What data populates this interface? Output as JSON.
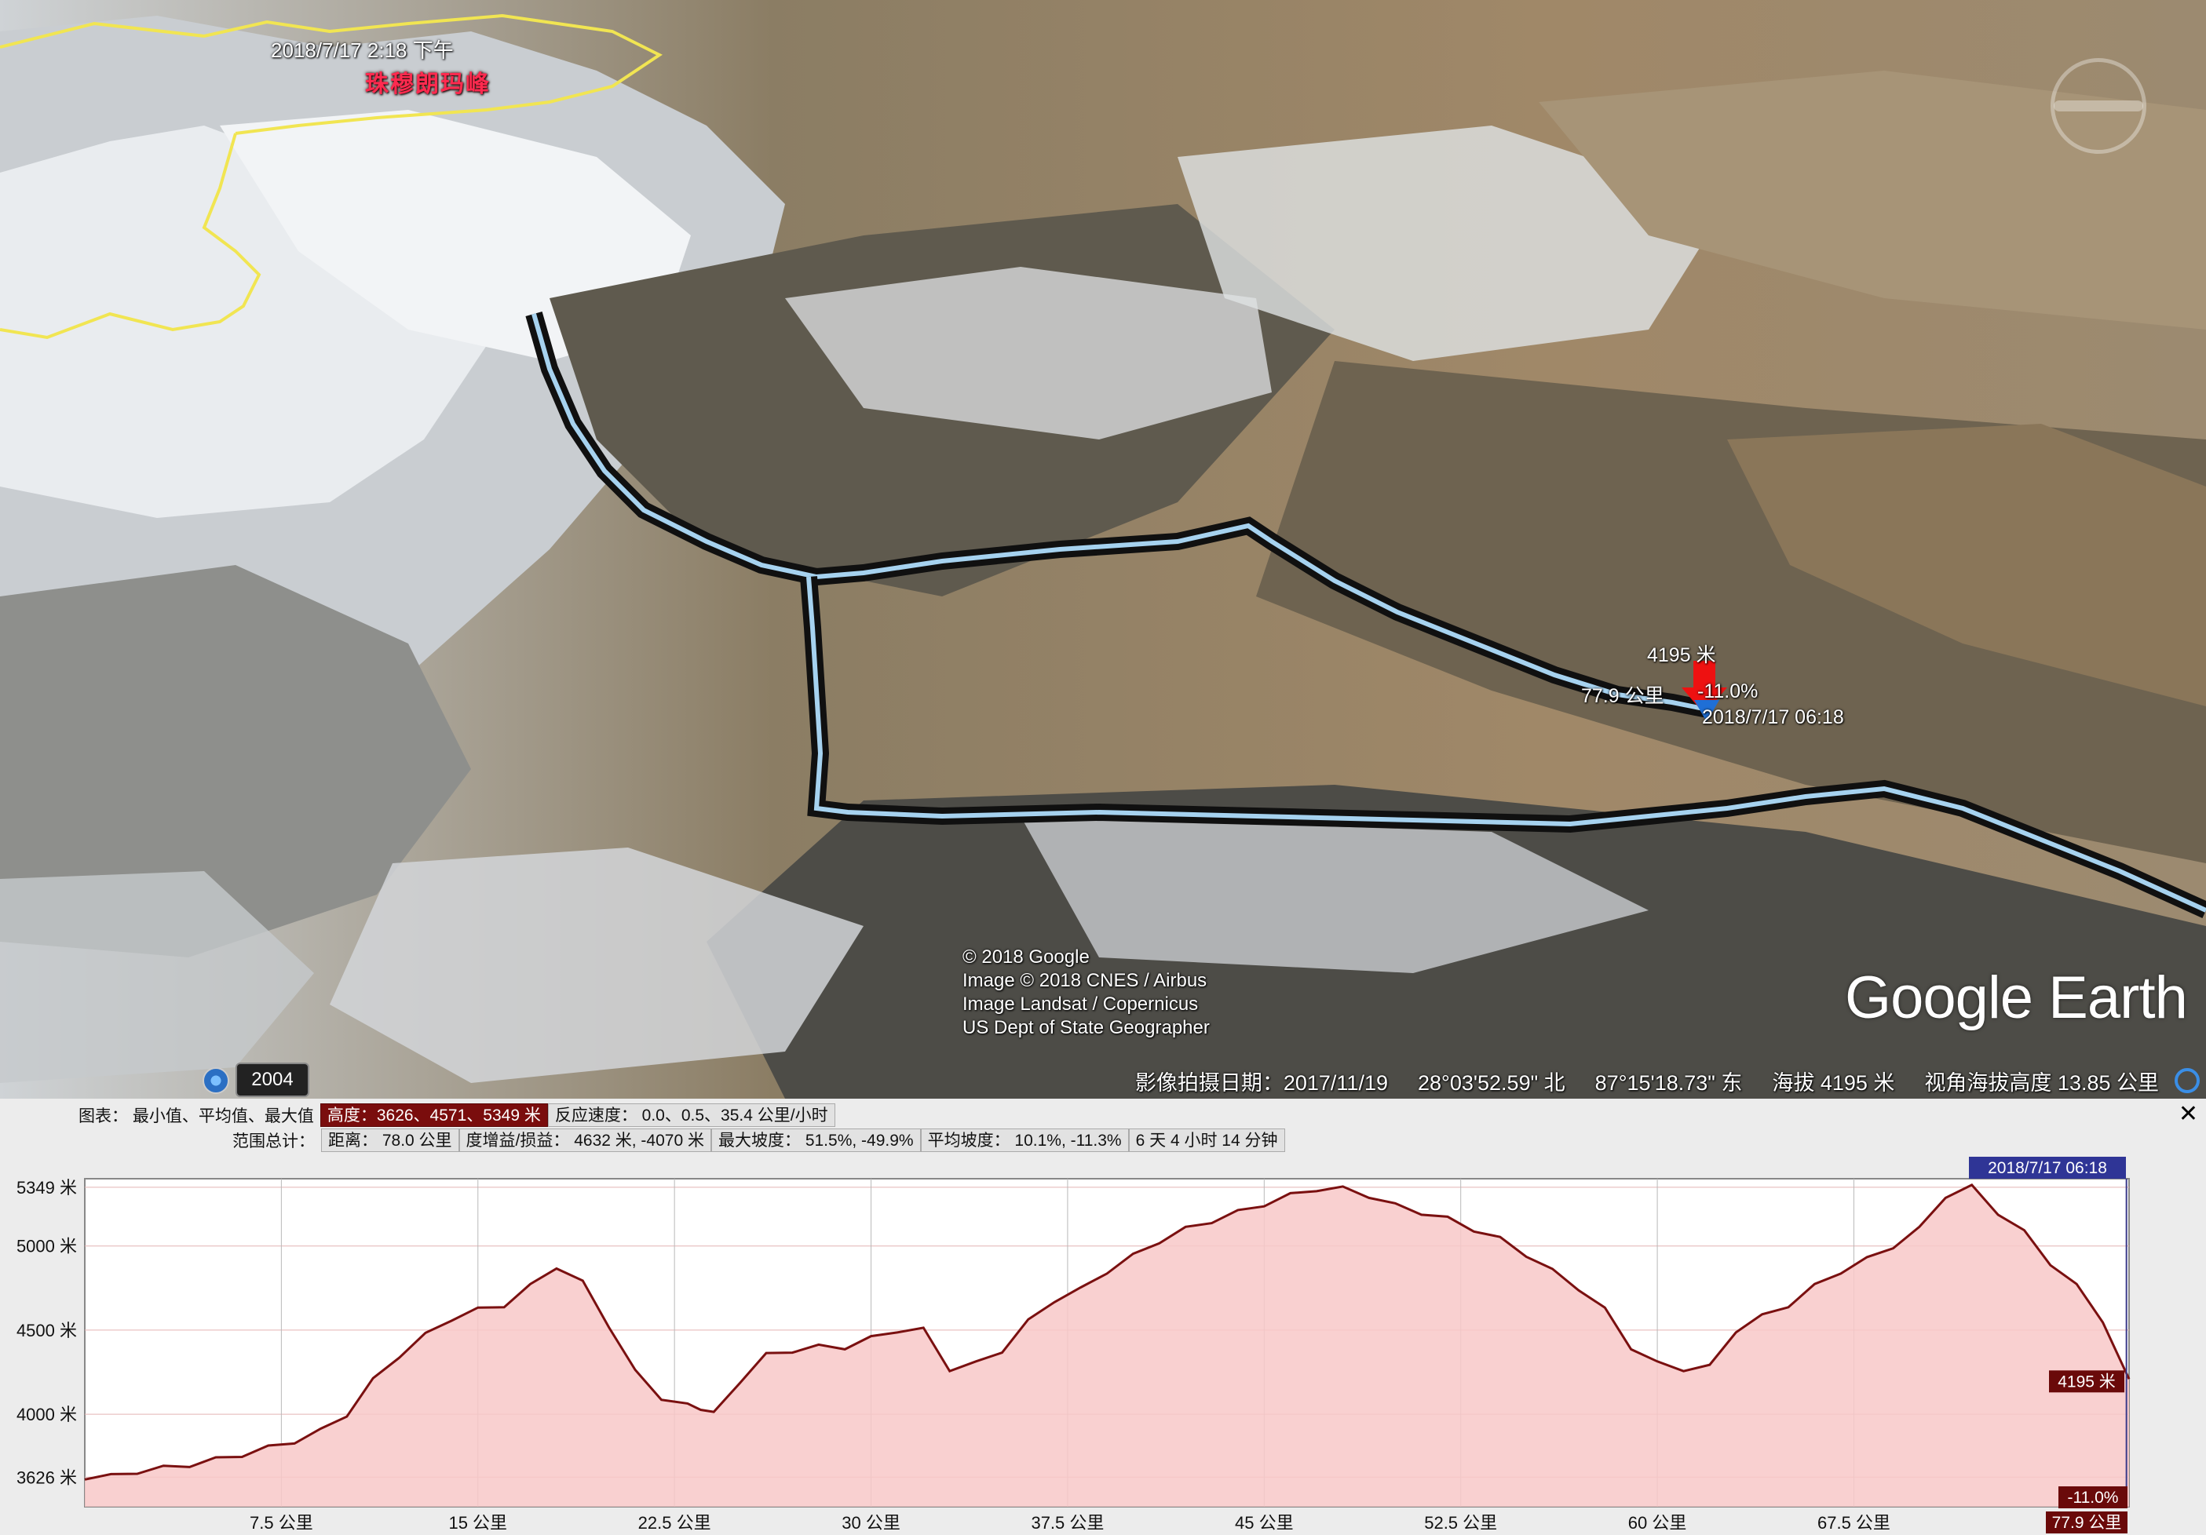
{
  "map": {
    "placemark_date": "2018/7/17  2:18 下午",
    "peak_label": "珠穆朗玛峰",
    "cursor": {
      "elevation": "4195 米",
      "distance": "77.9 公里",
      "grade": "-11.0%",
      "time": "2018/7/17 06:18"
    },
    "copyright": [
      "© 2018 Google",
      "Image © 2018 CNES / Airbus",
      "Image Landsat / Copernicus",
      "US Dept of State Geographer"
    ],
    "logo": "Google Earth",
    "time_slider_year": "2004"
  },
  "status_bar": {
    "imagery_date": "影像拍摄日期：2017/11/19",
    "latitude": "28°03'52.59\" 北",
    "longitude": "87°15'18.73\" 东",
    "elevation": "海拔  4195 米",
    "eye_altitude": "视角海拔高度  13.85 公里"
  },
  "profile": {
    "chart_row_label": "图表：  最小值、平均值、最大值",
    "chart_cells": [
      "高度：3626、4571、5349 米",
      "反应速度：  0.0、0.5、35.4 公里/小时"
    ],
    "range_row_label": "范围总计：",
    "range_cells": [
      "距离：  78.0 公里",
      "度增益/损益：  4632 米, -4070 米",
      "最大坡度：  51.5%, -49.9%",
      "平均坡度：  10.1%, -11.3%",
      "6 天 4 小时 14 分钟"
    ],
    "cursor_time": "2018/7/17 06:18",
    "cursor_elevation": "4195 米",
    "cursor_grade": "-11.0%",
    "cursor_distance": "77.9 公里"
  },
  "chart_data": {
    "type": "area",
    "xlabel": "",
    "ylabel": "",
    "x_unit": "公里",
    "y_unit": "米",
    "xlim": [
      0,
      78.0
    ],
    "ylim": [
      3450,
      5400
    ],
    "y_ticks": [
      3626,
      4000,
      4500,
      5000,
      5349
    ],
    "y_tick_labels": [
      "3626 米",
      "4000 米",
      "4500 米",
      "5000 米",
      "5349 米"
    ],
    "x_ticks": [
      7.5,
      15,
      22.5,
      30,
      37.5,
      45,
      52.5,
      60,
      67.5
    ],
    "x_tick_labels": [
      "7.5 公里",
      "15 公里",
      "22.5 公里",
      "30 公里",
      "37.5 公里",
      "45 公里",
      "52.5 公里",
      "60 公里",
      "67.5 公里"
    ],
    "cursor_x": 77.9,
    "series": [
      {
        "x": [
          0,
          1,
          2,
          3,
          4,
          5,
          6,
          7,
          8,
          9,
          10,
          11,
          12,
          13,
          14,
          15,
          16,
          17,
          18,
          19,
          20,
          21,
          22,
          23,
          23.5,
          24,
          25,
          26,
          27,
          28,
          29,
          30,
          31,
          32,
          33,
          34,
          35,
          36,
          37,
          38,
          39,
          40,
          41,
          42,
          43,
          44,
          45,
          46,
          47,
          48,
          49,
          50,
          51,
          52,
          53,
          54,
          55,
          56,
          57,
          58,
          59,
          60,
          61,
          62,
          63,
          64,
          65,
          66,
          67,
          68,
          69,
          70,
          71,
          72,
          73,
          74,
          75,
          76,
          77,
          78
        ],
        "y": [
          3626,
          3630,
          3660,
          3680,
          3700,
          3730,
          3760,
          3800,
          3840,
          3900,
          4000,
          4200,
          4350,
          4470,
          4570,
          4620,
          4650,
          4760,
          4880,
          4780,
          4530,
          4250,
          4100,
          4050,
          4040,
          4000,
          4200,
          4350,
          4380,
          4400,
          4400,
          4450,
          4500,
          4500,
          4270,
          4300,
          4380,
          4550,
          4680,
          4740,
          4850,
          4940,
          5030,
          5100,
          5150,
          5200,
          5250,
          5300,
          5340,
          5340,
          5300,
          5240,
          5200,
          5160,
          5100,
          5040,
          4950,
          4850,
          4750,
          4620,
          4400,
          4300,
          4270,
          4280,
          4500,
          4580,
          4650,
          4760,
          4850,
          4920,
          5000,
          5100,
          5300,
          5349,
          5200,
          5080,
          4900,
          4760,
          4560,
          4195
        ]
      }
    ]
  }
}
